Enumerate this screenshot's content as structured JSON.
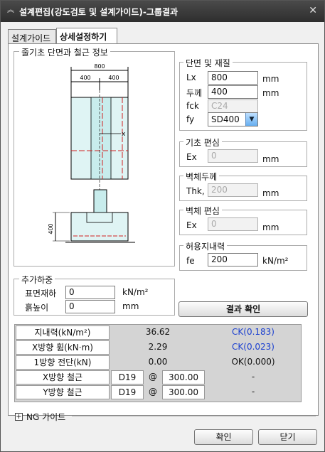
{
  "window": {
    "title": "설계편집(강도검토 및 설계가이드)-그룹결과",
    "collapse_icon": "double-chevron-up-icon",
    "close_icon": "close-icon"
  },
  "tabs": [
    {
      "label": "설계가이드"
    },
    {
      "label": "상세설정하기"
    }
  ],
  "diagram": {
    "legend": "줄기초 단면과 철근 정보",
    "dim_total": "800",
    "dim_left": "400",
    "dim_right": "400",
    "dim_height": "400",
    "axis_label": "x"
  },
  "section": {
    "legend": "단면 및 재질",
    "lx_label": "Lx",
    "lx_value": "800",
    "lx_unit": "mm",
    "thick_label": "두께",
    "thick_value": "400",
    "thick_unit": "mm",
    "fck_label": "fck",
    "fck_value": "C24",
    "fy_label": "fy",
    "fy_value": "SD400"
  },
  "foundation_ecc": {
    "legend": "기초 편심",
    "ex_label": "Ex",
    "ex_value": "0",
    "unit": "mm"
  },
  "wall_thickness": {
    "legend": "벽체두께",
    "thk_label": "Thk,",
    "thk_value": "200",
    "unit": "mm"
  },
  "wall_ecc": {
    "legend": "벽체 편심",
    "ex_label": "Ex",
    "ex_value": "0",
    "unit": "mm"
  },
  "bearing": {
    "legend": "허용지내력",
    "fe_label": "fe",
    "fe_value": "200",
    "unit": "kN/m²"
  },
  "extra_load": {
    "legend": "추가하중",
    "surface_label": "표면재하",
    "surface_value": "0",
    "surface_unit": "kN/m²",
    "soil_label": "흙높이",
    "soil_value": "0",
    "soil_unit": "mm"
  },
  "check_button": "결과 확인",
  "results": {
    "rows": [
      {
        "label": "지내력(kN/m²)",
        "value": "36.62",
        "status": "CK(0.183)"
      },
      {
        "label": "X방향 휨(kN·m)",
        "value": "2.29",
        "status": "CK(0.023)"
      },
      {
        "label": "1방향 전단(kN)",
        "value": "0.00",
        "status": "OK(0.000)"
      }
    ],
    "rebar": [
      {
        "label": "X방향 철근",
        "bar": "D19",
        "at": "@",
        "spacing": "300.00",
        "status": "-"
      },
      {
        "label": "Y방향 철근",
        "bar": "D19",
        "at": "@",
        "spacing": "300.00",
        "status": "-"
      }
    ]
  },
  "ng_guide": {
    "label": "NG 가이드",
    "icon": "expand-plus-icon"
  },
  "footer": {
    "ok": "확인",
    "close": "닫기"
  },
  "colors": {
    "title_bg": "#3a3a3a",
    "ck_blue": "#1a3fd0",
    "concrete": "#dff4f4",
    "rebar_red": "#d02020"
  }
}
